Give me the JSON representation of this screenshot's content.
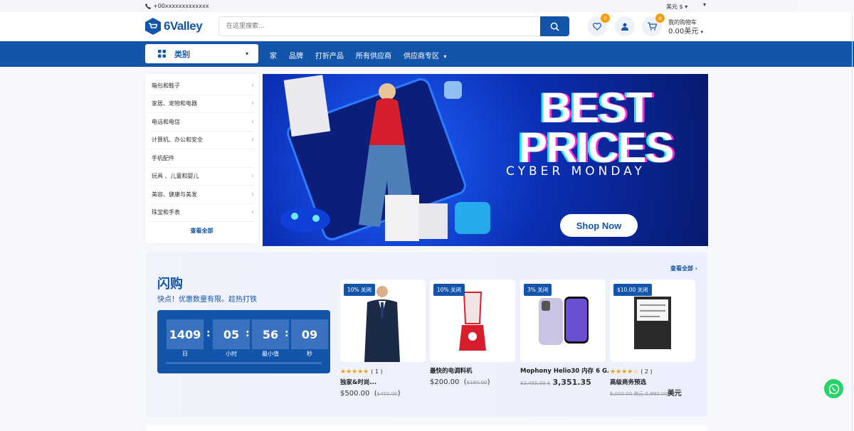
{
  "topbar": {
    "phone": "+00xxxxxxxxxxxxx",
    "currency": "美元 $",
    "currency_chevron": "▾",
    "lang_chevron": "▾"
  },
  "header": {
    "logo_text": "6Valley",
    "search_placeholder": "在这里搜索...",
    "wishlist_count": "0",
    "cart_count": "0",
    "cart_label": "我的购物车",
    "cart_amount": "0.00美元"
  },
  "nav": {
    "category_button": "类别",
    "links": [
      "家",
      "品牌",
      "打折产品",
      "所有供应商",
      "供应商专区"
    ]
  },
  "categories": {
    "items": [
      "箱包和鞋子",
      "家居、宠物和电器",
      "电话和电信",
      "计算机、办公和安全",
      "手机配件",
      "玩具 、儿童和婴儿",
      "美容、健康与美发",
      "珠宝和手表"
    ],
    "view_all": "查看全部"
  },
  "banner": {
    "line1": "BEST",
    "line2": "PRICES",
    "line3": "CYBER MONDAY",
    "cta": "Shop Now"
  },
  "flash": {
    "title": "闪购",
    "subtitle": "快点！优惠数量有限。趁热打铁",
    "see_all": "查看全部",
    "timer": {
      "days": "1409",
      "hours": "05",
      "minutes": "56",
      "seconds": "09",
      "days_label": "日",
      "hours_label": "小时",
      "minutes_label": "最小值",
      "seconds_label": "秒"
    },
    "products": [
      {
        "discount": "10% 关闭",
        "rating": 5,
        "reviews": "( 1 )",
        "name": "独家&时尚...",
        "price": "$500.00",
        "old_price": "$450.00"
      },
      {
        "discount": "10% 关闭",
        "rating": 0,
        "reviews": "",
        "name": "最快的电调料机",
        "price": "$200.00",
        "old_price": "$180.00"
      },
      {
        "discount": "3% 关闭",
        "rating": 0,
        "reviews": "",
        "name": "Mophony Helio30 内存 6 G...",
        "price": "3,351.35",
        "old_price": "$3,455.00 $"
      },
      {
        "discount": "$10.00 关闭",
        "rating": 4.5,
        "reviews": "( 2 )",
        "name": "高级商务预选",
        "price": "美元",
        "old_price": "6,000.00 美元 5,990.00"
      }
    ]
  },
  "colors": {
    "primary": "#1455ac",
    "accent": "#f59e0b",
    "whatsapp": "#25d366"
  }
}
